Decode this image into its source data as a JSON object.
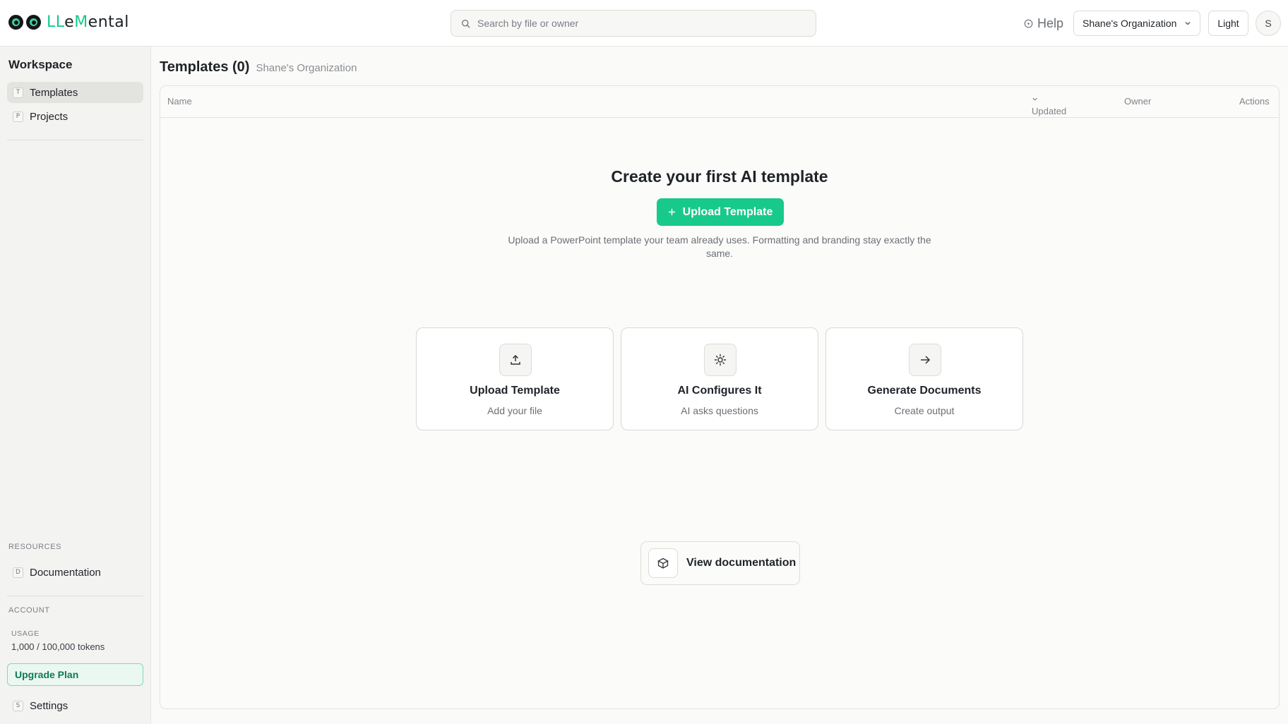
{
  "brand": {
    "name_part1": "LL",
    "name_part2": "e",
    "name_part3": "M",
    "name_part4": "ental",
    "accent_color": "#17c98a"
  },
  "topbar": {
    "search_placeholder": "Search by file or owner",
    "help_label": "Help",
    "org_label": "Shane's Organization",
    "theme_label": "Light",
    "avatar_initial": "S"
  },
  "sidebar": {
    "title": "Workspace",
    "items": [
      {
        "badge": "T",
        "label": "Templates",
        "active": true
      },
      {
        "badge": "P",
        "label": "Projects",
        "active": false
      }
    ],
    "resources_heading": "RESOURCES",
    "resources": [
      {
        "badge": "D",
        "label": "Documentation"
      }
    ],
    "account_heading": "ACCOUNT",
    "usage_label": "USAGE",
    "usage_value": "1,000 / 100,000 tokens",
    "upgrade_label": "Upgrade Plan",
    "settings": {
      "badge": "S",
      "label": "Settings"
    }
  },
  "main": {
    "title": "Templates (0)",
    "subtitle": "Shane's Organization",
    "columns": {
      "name": "Name",
      "updated": "Updated",
      "owner": "Owner",
      "actions": "Actions"
    },
    "empty": {
      "title": "Create your first AI template",
      "button_label": "Upload Template",
      "description": "Upload a PowerPoint template your team already uses. Formatting and branding stay exactly the same."
    },
    "steps": [
      {
        "icon": "upload-icon",
        "title": "Upload Template",
        "subtitle": "Add your file"
      },
      {
        "icon": "sun-icon",
        "title": "AI Configures It",
        "subtitle": "AI asks questions"
      },
      {
        "icon": "arrow-right-icon",
        "title": "Generate Documents",
        "subtitle": "Create output"
      }
    ],
    "docs_button_label": "View documentation"
  }
}
